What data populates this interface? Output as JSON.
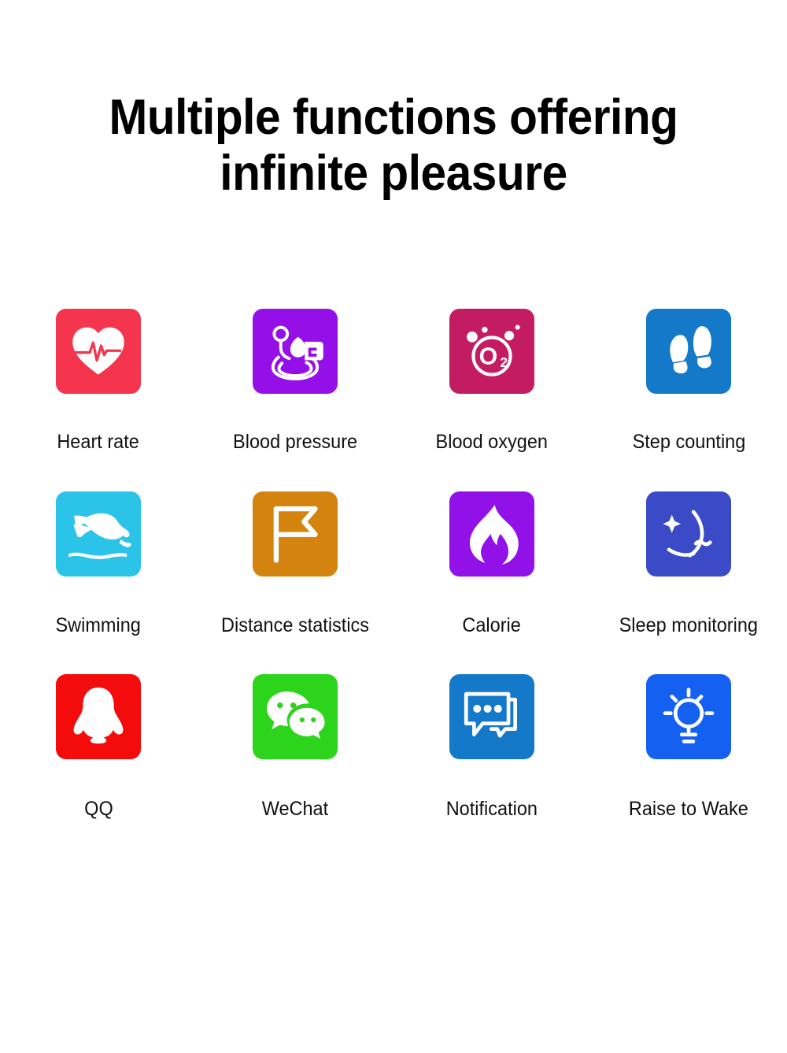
{
  "page": {
    "background_color": "#ffffff",
    "title": "Multiple functions offering\ninfinite pleasure"
  },
  "features": [
    {
      "label": "Heart rate",
      "icon": "heart-rate-icon",
      "tile_color": "#F5354E",
      "glyph_color": "#ffffff"
    },
    {
      "label": "Blood pressure",
      "icon": "blood-pressure-monitor-icon",
      "tile_color": "#9510E8",
      "glyph_color": "#ffffff"
    },
    {
      "label": "Blood oxygen",
      "icon": "blood-oxygen-o2-icon",
      "tile_color": "#C41C63",
      "glyph_color": "#ffffff"
    },
    {
      "label": "Step counting",
      "icon": "footprints-icon",
      "tile_color": "#1379C8",
      "glyph_color": "#ffffff"
    },
    {
      "label": "Swimming",
      "icon": "swimmer-icon",
      "tile_color": "#2BC4E8",
      "glyph_color": "#ffffff"
    },
    {
      "label": "Distance statistics",
      "icon": "flag-icon",
      "tile_color": "#D4840E",
      "glyph_color": "#ffffff"
    },
    {
      "label": "Calorie",
      "icon": "flame-icon",
      "tile_color": "#9211E8",
      "glyph_color": "#ffffff"
    },
    {
      "label": "Sleep monitoring",
      "icon": "moon-star-icon",
      "tile_color": "#3B4BC8",
      "glyph_color": "#ffffff"
    },
    {
      "label": "QQ",
      "icon": "qq-penguin-icon",
      "tile_color": "#F40B0B",
      "glyph_color": "#ffffff"
    },
    {
      "label": "WeChat",
      "icon": "wechat-bubbles-icon",
      "tile_color": "#2DD41C",
      "glyph_color": "#ffffff"
    },
    {
      "label": "Notification",
      "icon": "chat-bubbles-dots-icon",
      "tile_color": "#1379C8",
      "glyph_color": "#ffffff"
    },
    {
      "label": "Raise to Wake",
      "icon": "lightbulb-rays-icon",
      "tile_color": "#1460F0",
      "glyph_color": "#ffffff"
    }
  ]
}
